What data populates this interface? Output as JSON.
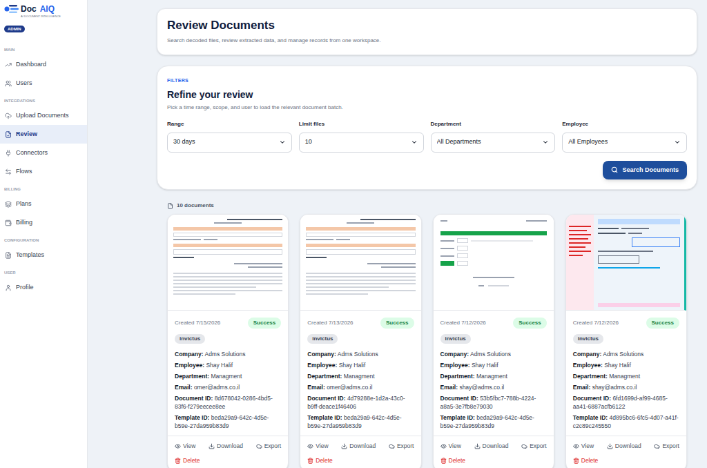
{
  "brand": {
    "name_first": "Doc",
    "name_second": "AIQ",
    "tagline": "AI DOCUMENT INTELLIGENCE",
    "role": "ADMIN"
  },
  "sidebar": {
    "sections": [
      {
        "label": "MAIN",
        "items": [
          {
            "label": "Dashboard",
            "selected": false
          },
          {
            "label": "Users",
            "selected": false
          }
        ]
      },
      {
        "label": "INTEGRATIONS",
        "items": [
          {
            "label": "Upload Documents",
            "selected": false
          },
          {
            "label": "Review",
            "selected": true
          },
          {
            "label": "Connectors",
            "selected": false
          },
          {
            "label": "Flows",
            "selected": false
          }
        ]
      },
      {
        "label": "BILLING",
        "items": [
          {
            "label": "Plans",
            "selected": false
          },
          {
            "label": "Billing",
            "selected": false
          }
        ]
      },
      {
        "label": "CONFIGURATION",
        "items": [
          {
            "label": "Templates",
            "selected": false
          }
        ]
      },
      {
        "label": "USER",
        "items": [
          {
            "label": "Profile",
            "selected": false
          }
        ]
      }
    ]
  },
  "header": {
    "title": "Review Documents",
    "subtitle": "Search decoded files, review extracted data, and manage records from one workspace."
  },
  "filters": {
    "eyebrow": "FILTERS",
    "title": "Refine your review",
    "description": "Pick a time range, scope, and user to load the relevant document batch.",
    "fields": [
      {
        "label": "Range",
        "value": "30 days"
      },
      {
        "label": "Limit files",
        "value": "10"
      },
      {
        "label": "Department",
        "value": "All Departments"
      },
      {
        "label": "Employee",
        "value": "All Employees"
      }
    ],
    "button": "Search Documents"
  },
  "results": {
    "count": "10 documents",
    "cards": [
      {
        "thumbnail": "letter",
        "created": "Created 7/15/2026",
        "status": "Success",
        "tag": "invictus",
        "fields": [
          {
            "label": "Company:",
            "value": "Adms Solutions"
          },
          {
            "label": "Employee:",
            "value": "Shay Halif"
          },
          {
            "label": "Department:",
            "value": "Managment"
          },
          {
            "label": "Email:",
            "value": "omer@adms.co.il"
          },
          {
            "label": "Document ID:",
            "value": "8d678042-0286-4bd5-83f6-f279eecee8ee"
          },
          {
            "label": "Template ID:",
            "value": "beda29a9-642c-4d5e-b59e-27da959b83d9"
          }
        ],
        "actions": [
          "View",
          "Download",
          "Export"
        ],
        "danger_action": "Delete"
      },
      {
        "thumbnail": "letter",
        "created": "Created 7/13/2026",
        "status": "Success",
        "tag": "invictus",
        "fields": [
          {
            "label": "Company:",
            "value": "Adms Solutions"
          },
          {
            "label": "Employee:",
            "value": "Shay Halif"
          },
          {
            "label": "Department:",
            "value": "Managment"
          },
          {
            "label": "Email:",
            "value": "omer@adms.co.il"
          },
          {
            "label": "Document ID:",
            "value": "4d79288e-1d2a-43c0-b9ff-deace1f46406"
          },
          {
            "label": "Template ID:",
            "value": "beda29a9-642c-4d5e-b59e-27da959b83d9"
          }
        ],
        "actions": [
          "View",
          "Download",
          "Export"
        ],
        "danger_action": "Delete"
      },
      {
        "thumbnail": "table",
        "created": "Created 7/12/2026",
        "status": "Success",
        "tag": "invictus",
        "fields": [
          {
            "label": "Company:",
            "value": "Adms Solutions"
          },
          {
            "label": "Employee:",
            "value": "Shay Halif"
          },
          {
            "label": "Department:",
            "value": "Managment"
          },
          {
            "label": "Email:",
            "value": "shay@adms.co.il"
          },
          {
            "label": "Document ID:",
            "value": "53b5fbc7-788b-4224-a8a5-3e7fb8e79030"
          },
          {
            "label": "Template ID:",
            "value": "beda29a9-642c-4d5e-b59e-27da959b83d9"
          }
        ],
        "actions": [
          "View",
          "Download",
          "Export"
        ],
        "danger_action": "Delete"
      },
      {
        "thumbnail": "form",
        "created": "Created 7/12/2026",
        "status": "Success",
        "tag": "invictus",
        "fields": [
          {
            "label": "Company:",
            "value": "Adms Solutions"
          },
          {
            "label": "Employee:",
            "value": "Shay Halif"
          },
          {
            "label": "Department:",
            "value": "Managment"
          },
          {
            "label": "Email:",
            "value": "shay@adms.co.il"
          },
          {
            "label": "Document ID:",
            "value": "6fd1699d-af99-4685-aa41-6887acfb6122"
          },
          {
            "label": "Template ID:",
            "value": "4d895bc6-6fc5-4d07-a41f-c2c89c245550"
          }
        ],
        "actions": [
          "View",
          "Download",
          "Export"
        ],
        "danger_action": "Delete"
      }
    ]
  }
}
